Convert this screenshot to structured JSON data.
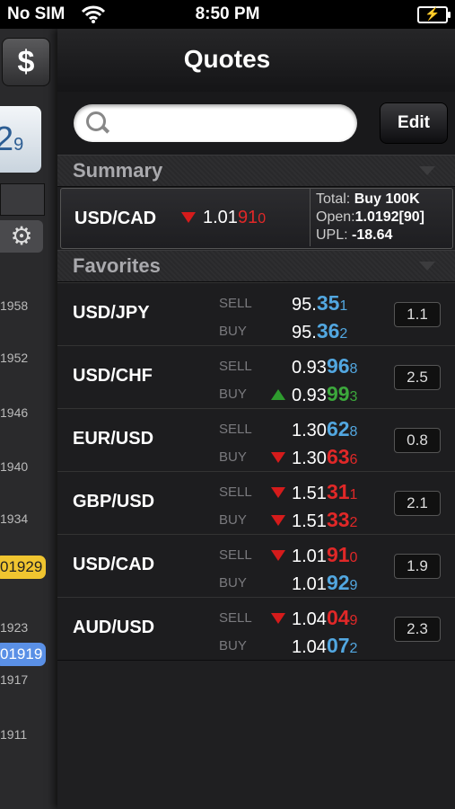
{
  "status": {
    "carrier": "No SIM",
    "time": "8:50 PM"
  },
  "left": {
    "quote_big": "2",
    "quote_small": "9",
    "ticks": [
      "1958",
      "1952",
      "1946",
      "1940",
      "1934",
      "1923",
      "1917",
      "1911"
    ],
    "pill_yellow": "01929",
    "pill_blue": "01919"
  },
  "nav": {
    "title": "Quotes"
  },
  "search": {
    "value": "",
    "placeholder": ""
  },
  "edit_label": "Edit",
  "summary": {
    "section_label": "Summary",
    "pair": "USD/CAD",
    "price_prefix": "1.01",
    "price_big": "91",
    "price_small": "0",
    "total_label": "Total:",
    "total_value": "Buy 100K",
    "open_label": "Open:",
    "open_value": "1.0192[90]",
    "upl_label": "UPL:",
    "upl_value": "-18.64"
  },
  "favorites": {
    "section_label": "Favorites",
    "sell_label": "SELL",
    "buy_label": "BUY",
    "rows": [
      {
        "pair": "USD/JPY",
        "spread": "1.1",
        "sell": {
          "prefix": "95.",
          "big": "35",
          "small": "1",
          "color": "blue",
          "arrow": ""
        },
        "buy": {
          "prefix": "95.",
          "big": "36",
          "small": "2",
          "color": "blue",
          "arrow": ""
        }
      },
      {
        "pair": "USD/CHF",
        "spread": "2.5",
        "sell": {
          "prefix": "0.93",
          "big": "96",
          "small": "8",
          "color": "blue",
          "arrow": ""
        },
        "buy": {
          "prefix": "0.93",
          "big": "99",
          "small": "3",
          "color": "green",
          "arrow": "up"
        }
      },
      {
        "pair": "EUR/USD",
        "spread": "0.8",
        "sell": {
          "prefix": "1.30",
          "big": "62",
          "small": "8",
          "color": "blue",
          "arrow": ""
        },
        "buy": {
          "prefix": "1.30",
          "big": "63",
          "small": "6",
          "color": "red",
          "arrow": "down"
        }
      },
      {
        "pair": "GBP/USD",
        "spread": "2.1",
        "sell": {
          "prefix": "1.51",
          "big": "31",
          "small": "1",
          "color": "red",
          "arrow": "down"
        },
        "buy": {
          "prefix": "1.51",
          "big": "33",
          "small": "2",
          "color": "red",
          "arrow": "down"
        }
      },
      {
        "pair": "USD/CAD",
        "spread": "1.9",
        "sell": {
          "prefix": "1.01",
          "big": "91",
          "small": "0",
          "color": "red",
          "arrow": "down"
        },
        "buy": {
          "prefix": "1.01",
          "big": "92",
          "small": "9",
          "color": "blue",
          "arrow": ""
        }
      },
      {
        "pair": "AUD/USD",
        "spread": "2.3",
        "sell": {
          "prefix": "1.04",
          "big": "04",
          "small": "9",
          "color": "red",
          "arrow": "down"
        },
        "buy": {
          "prefix": "1.04",
          "big": "07",
          "small": "2",
          "color": "blue",
          "arrow": ""
        }
      }
    ]
  },
  "colors": {
    "up": "#3ca83c",
    "down": "#e02828",
    "neutral": "#52a7e0"
  }
}
